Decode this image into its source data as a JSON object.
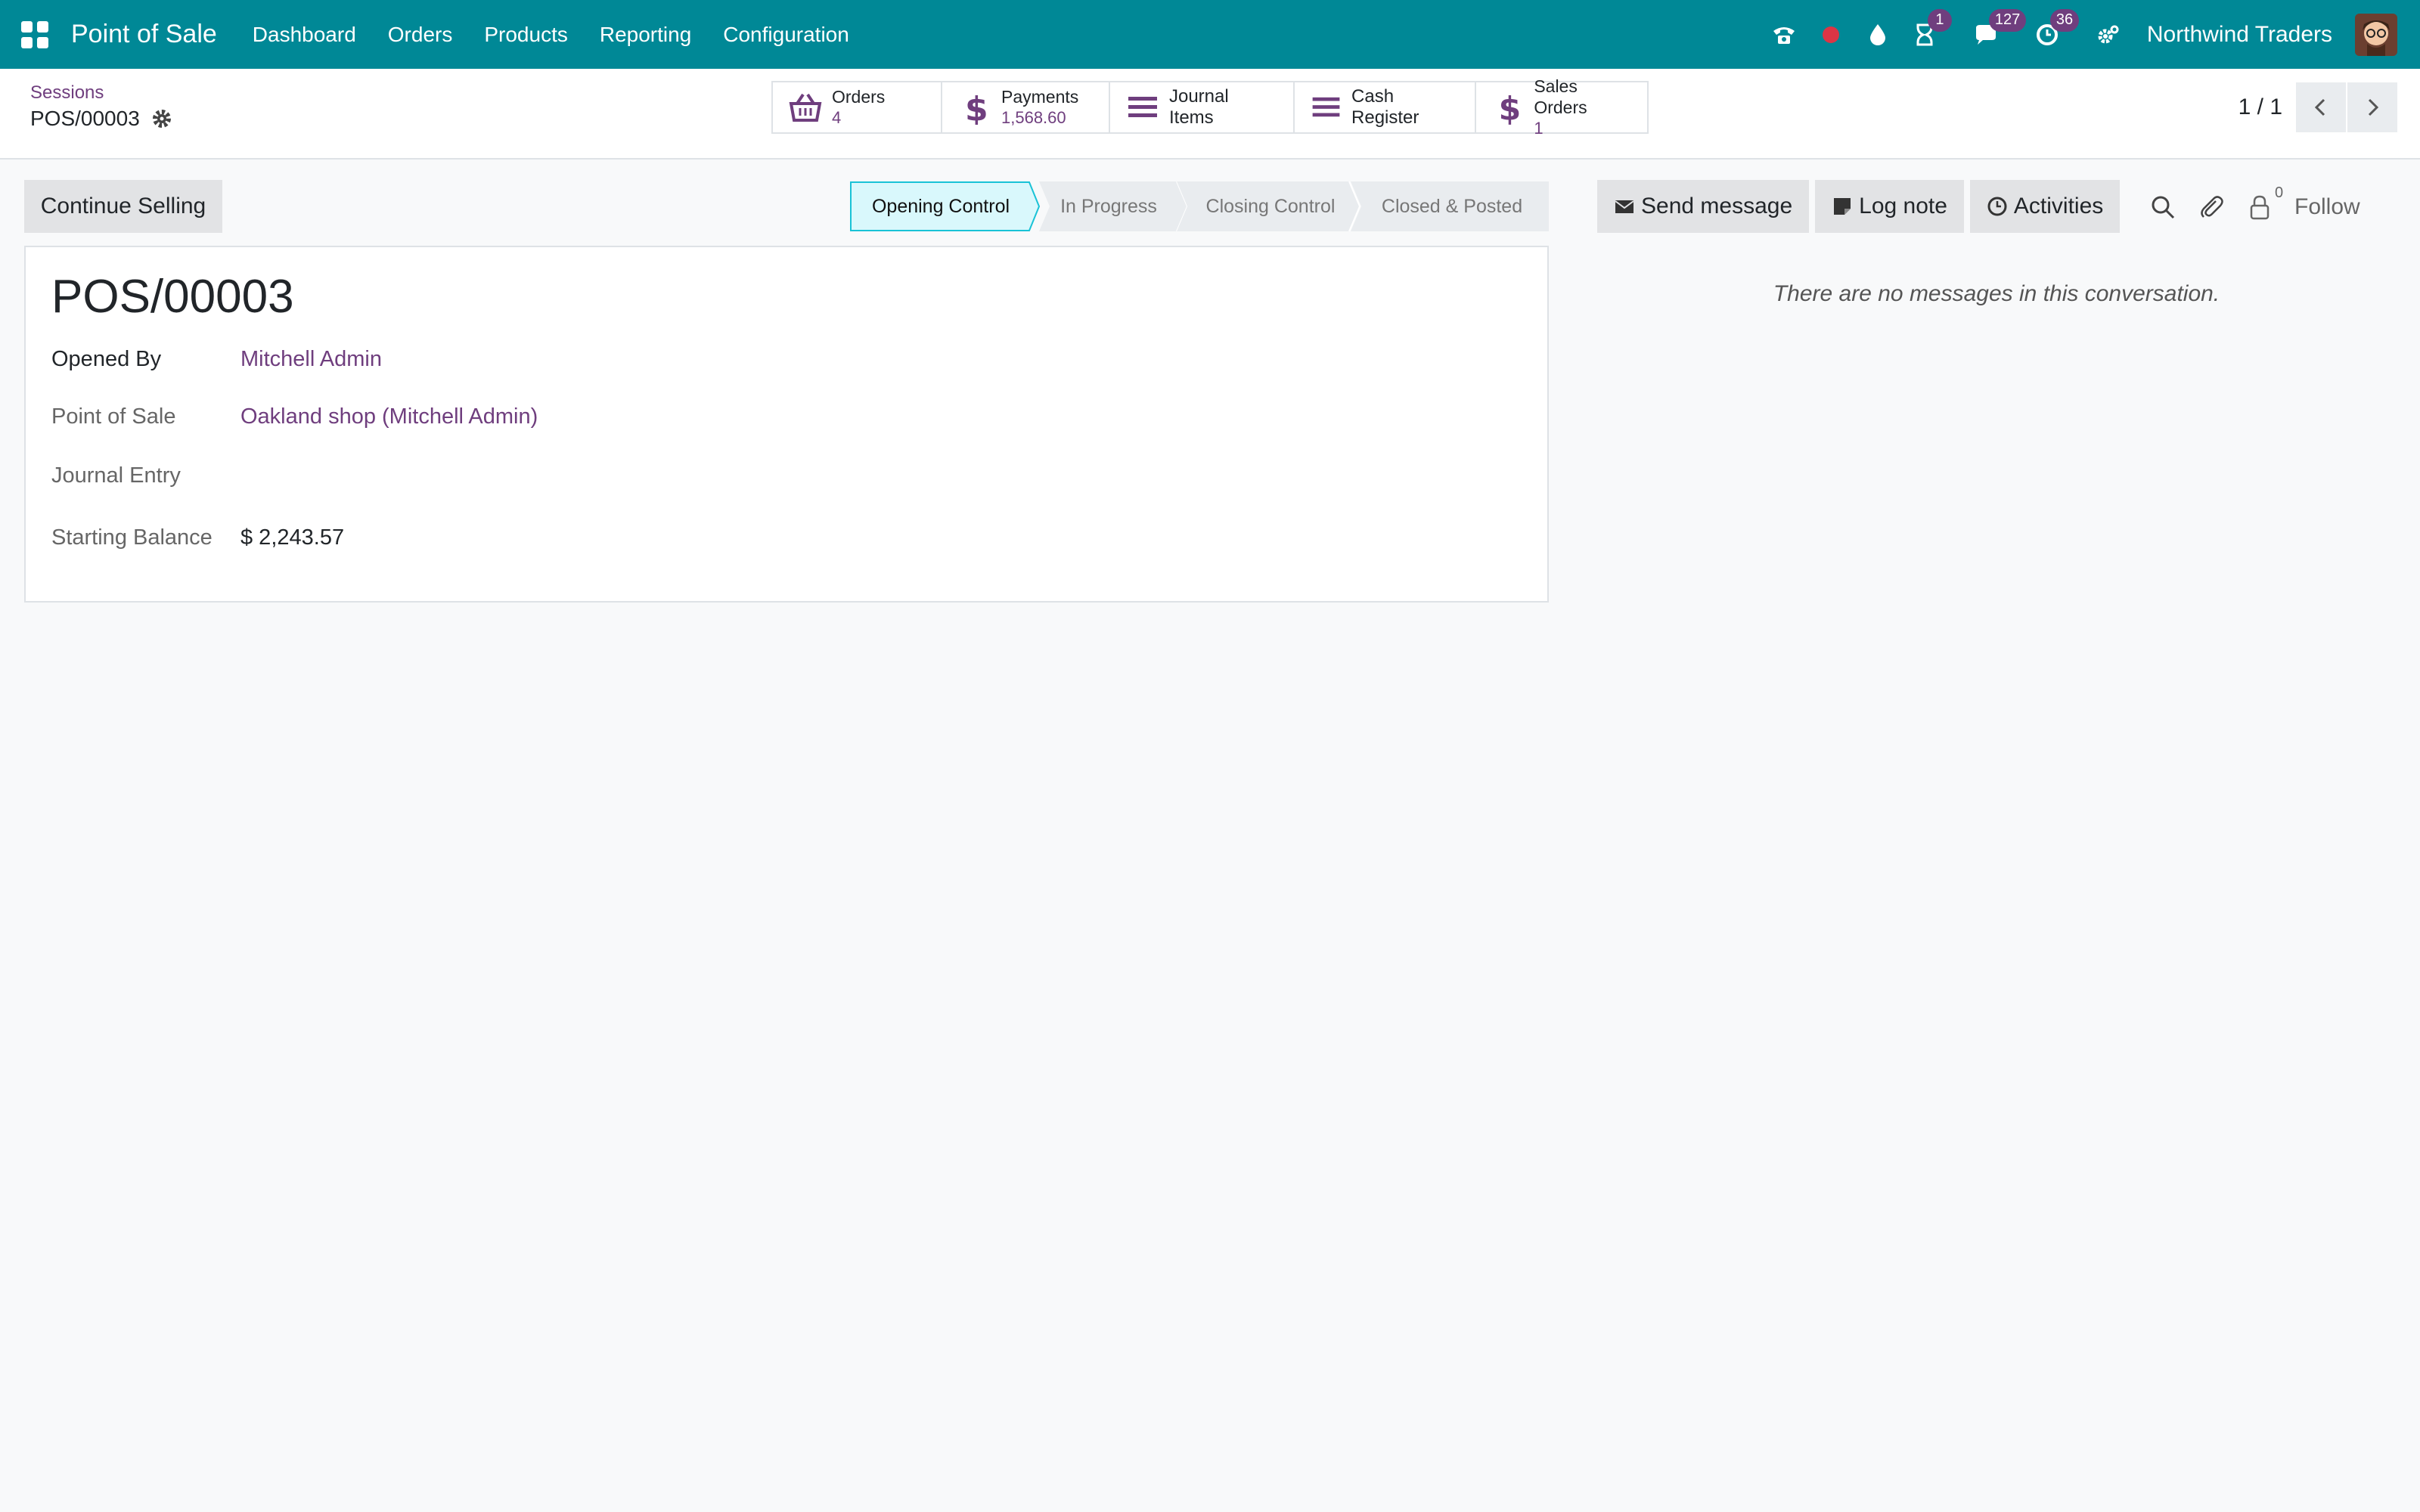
{
  "navbar": {
    "app_title": "Point of Sale",
    "menu": [
      "Dashboard",
      "Orders",
      "Products",
      "Reporting",
      "Configuration"
    ],
    "badges": {
      "activity": "1",
      "messages": "127",
      "clock": "36"
    },
    "company": "Northwind Traders",
    "bg_color": "#008896"
  },
  "control_panel": {
    "breadcrumb": "Sessions",
    "record_name": "POS/00003",
    "smart_buttons": {
      "orders": {
        "label": "Orders",
        "value": "4"
      },
      "payments": {
        "label": "Payments",
        "value": "1,568.60"
      },
      "journal_items": {
        "label": "Journal Items"
      },
      "cash_register": {
        "label": "Cash Register"
      },
      "sales_orders": {
        "label": "Sales Orders",
        "value": "1"
      }
    },
    "pager": "1 / 1"
  },
  "form": {
    "continue_label": "Continue Selling",
    "statusbar": [
      "Opening Control",
      "In Progress",
      "Closing Control",
      "Closed & Posted"
    ],
    "active_status": "Opening Control",
    "title": "POS/00003",
    "fields": {
      "opened_by": {
        "label": "Opened By",
        "value": "Mitchell Admin"
      },
      "point_of_sale": {
        "label": "Point of Sale",
        "value": "Oakland shop (Mitchell Admin)"
      },
      "journal_entry": {
        "label": "Journal Entry",
        "value": ""
      },
      "starting_balance": {
        "label": "Starting Balance",
        "value": "$ 2,243.57"
      }
    }
  },
  "chatter": {
    "send_message": "Send message",
    "log_note": "Log note",
    "activities": "Activities",
    "follower_count": "0",
    "follow": "Follow",
    "no_messages": "There are no messages in this conversation."
  },
  "colors": {
    "accent": "#6f3e7e",
    "active_step": "#d9f8fc",
    "active_step_border": "#19c2d6"
  }
}
